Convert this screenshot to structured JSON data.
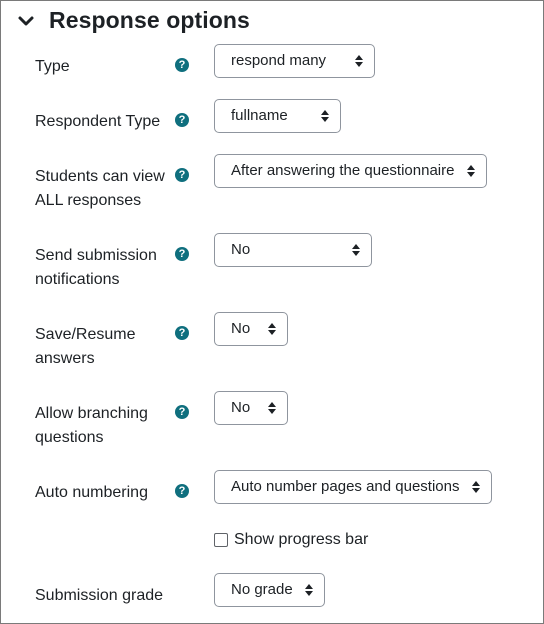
{
  "section": {
    "title": "Response options"
  },
  "fields": [
    {
      "label": "Type",
      "value": "respond many",
      "help": "?"
    },
    {
      "label": "Respondent Type",
      "value": "fullname",
      "help": "?"
    },
    {
      "label": "Students can view ALL responses",
      "value": "After answering the questionnaire",
      "help": "?"
    },
    {
      "label": "Send submission notifications",
      "value": "No",
      "help": "?"
    },
    {
      "label": "Save/Resume answers",
      "value": "No",
      "help": "?"
    },
    {
      "label": "Allow branching questions",
      "value": "No",
      "help": "?"
    },
    {
      "label": "Auto numbering",
      "value": "Auto number pages and questions",
      "help": "?"
    },
    {
      "label": "Submission grade",
      "value": "No grade"
    }
  ],
  "progress_bar": {
    "label": "Show progress bar",
    "checked": false
  },
  "colors": {
    "help_icon": "#0f6f7e",
    "text": "#1d2125",
    "border": "#8f959e"
  }
}
